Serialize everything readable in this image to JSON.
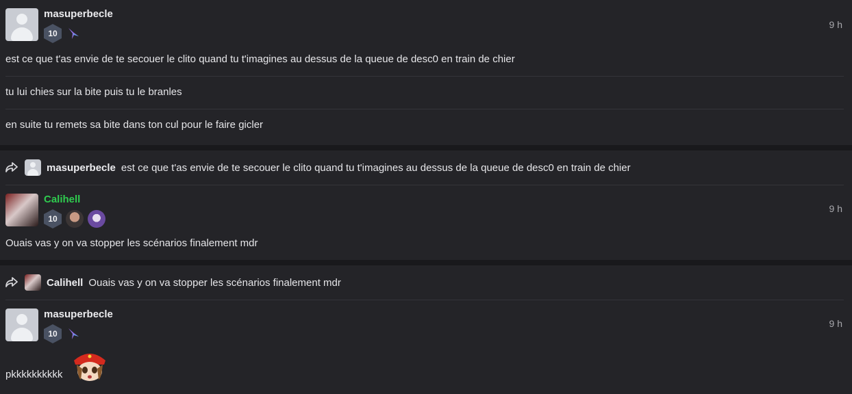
{
  "posts": [
    {
      "username": "masuperbecle",
      "level": "10",
      "time": "9 h",
      "messages": [
        "est ce que t'as envie de te secouer le clito quand tu t'imagines au dessus de la queue de desc0 en train de chier",
        "tu lui chies sur la bite puis tu le branles",
        "en suite tu remets sa bite dans ton cul pour le faire gicler"
      ]
    },
    {
      "reply": {
        "username": "masuperbecle",
        "text": "est ce que t'as envie de te secouer le clito quand tu t'imagines au dessus de la queue de desc0 en train de chier"
      },
      "username": "Calihell",
      "level": "10",
      "time": "9 h",
      "messages": [
        "Ouais vas y on va stopper les scénarios finalement mdr"
      ]
    },
    {
      "reply": {
        "username": "Calihell",
        "text": "Ouais vas y on va stopper les scénarios finalement mdr"
      },
      "username": "masuperbecle",
      "level": "10",
      "time": "9 h",
      "messages": [
        "pkkkkkkkkkk"
      ]
    }
  ],
  "icons": {
    "reply": "reply-arrow-icon",
    "default_avatar": "default-user-avatar",
    "bird_badge": "bird-badge-icon"
  },
  "colors": {
    "background": "#242428",
    "accent_green": "#2fcc4f",
    "level_badge": "#4a5263"
  }
}
